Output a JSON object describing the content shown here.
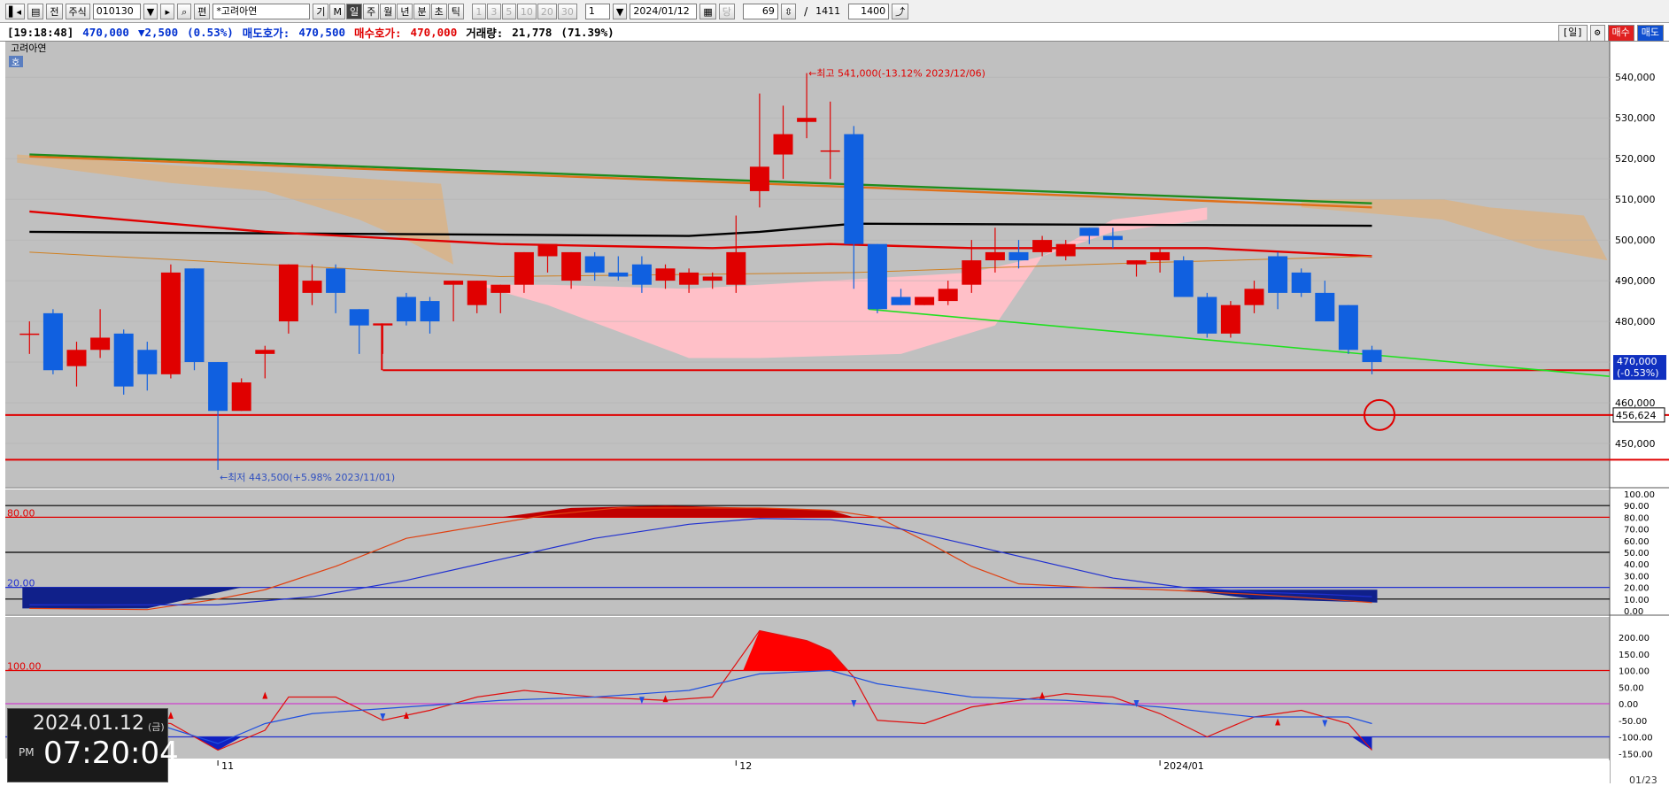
{
  "toolbar": {
    "market_btn": "전",
    "type_label": "주식",
    "code": "010130",
    "search_glyph": "🔍",
    "name_prefix": "편",
    "name": "*고려아연",
    "periods": [
      "기",
      "M",
      "일",
      "주",
      "월",
      "년",
      "분",
      "초",
      "틱"
    ],
    "active_period": "일",
    "intervals": [
      "1",
      "3",
      "5",
      "10",
      "20",
      "30"
    ],
    "interval_value": "1",
    "date": "2024/01/12",
    "mode_label": "당",
    "page_count": "69",
    "page_sep": "/",
    "page_total": "1411",
    "bar_count": "1400"
  },
  "infobar": {
    "time": "[19:18:48]",
    "price": "470,000",
    "change": "▼2,500",
    "change_pct": "(0.53%)",
    "ask_label": "매도호가:",
    "ask_value": "470,500",
    "bid_label": "매수호가:",
    "bid_value": "470,000",
    "volume_label": "거래량:",
    "volume_value": "21,778",
    "volume_pct": "(71.39%)",
    "right_btns": [
      "[일]",
      "⚙",
      "매수",
      "매도"
    ]
  },
  "chart_data": [
    {
      "type": "candlestick",
      "title": "고려아연",
      "badge": "호",
      "ylim": [
        440000,
        547000
      ],
      "yticks": [
        450000,
        460000,
        470000,
        480000,
        490000,
        500000,
        510000,
        520000,
        530000,
        540000
      ],
      "ytick_labels": [
        "450,000",
        "460,000",
        "470,000",
        "480,000",
        "490,000",
        "500,000",
        "510,000",
        "520,000",
        "530,000",
        "540,000"
      ],
      "x_labels": [
        {
          "index": 8,
          "text": "11"
        },
        {
          "index": 30,
          "text": "12"
        },
        {
          "index": 48,
          "text": "2024/01"
        }
      ],
      "candles": [
        {
          "o": 477000,
          "h": 480000,
          "l": 472000,
          "c": 477000
        },
        {
          "o": 482000,
          "h": 483000,
          "l": 467000,
          "c": 468000
        },
        {
          "o": 469000,
          "h": 475000,
          "l": 464000,
          "c": 473000
        },
        {
          "o": 473000,
          "h": 483000,
          "l": 471000,
          "c": 476000
        },
        {
          "o": 477000,
          "h": 478000,
          "l": 462000,
          "c": 464000
        },
        {
          "o": 473000,
          "h": 475000,
          "l": 463000,
          "c": 467000
        },
        {
          "o": 467000,
          "h": 494000,
          "l": 466000,
          "c": 492000
        },
        {
          "o": 493000,
          "h": 493000,
          "l": 468000,
          "c": 470000
        },
        {
          "o": 470000,
          "h": 470000,
          "l": 443500,
          "c": 458000
        },
        {
          "o": 458000,
          "h": 466000,
          "l": 458000,
          "c": 465000
        },
        {
          "o": 472000,
          "h": 474000,
          "l": 466000,
          "c": 473000
        },
        {
          "o": 480000,
          "h": 494000,
          "l": 477000,
          "c": 494000
        },
        {
          "o": 487000,
          "h": 494000,
          "l": 484000,
          "c": 490000
        },
        {
          "o": 493000,
          "h": 494000,
          "l": 482000,
          "c": 487000
        },
        {
          "o": 483000,
          "h": 483000,
          "l": 472000,
          "c": 479000
        },
        {
          "o": 479000,
          "h": 479000,
          "l": 472000,
          "c": 479500
        },
        {
          "o": 486000,
          "h": 487000,
          "l": 479000,
          "c": 480000
        },
        {
          "o": 485000,
          "h": 486000,
          "l": 477000,
          "c": 480000
        },
        {
          "o": 489000,
          "h": 490000,
          "l": 480000,
          "c": 490000
        },
        {
          "o": 484000,
          "h": 490000,
          "l": 482000,
          "c": 490000
        },
        {
          "o": 487000,
          "h": 489000,
          "l": 482000,
          "c": 489000
        },
        {
          "o": 489000,
          "h": 497000,
          "l": 487000,
          "c": 497000
        },
        {
          "o": 496000,
          "h": 497000,
          "l": 492000,
          "c": 499000
        },
        {
          "o": 490000,
          "h": 497000,
          "l": 488000,
          "c": 497000
        },
        {
          "o": 496000,
          "h": 497000,
          "l": 490000,
          "c": 492000
        },
        {
          "o": 492000,
          "h": 496000,
          "l": 490000,
          "c": 491000
        },
        {
          "o": 494000,
          "h": 496000,
          "l": 487000,
          "c": 489000
        },
        {
          "o": 490000,
          "h": 494000,
          "l": 488000,
          "c": 493000
        },
        {
          "o": 489000,
          "h": 493000,
          "l": 487000,
          "c": 492000
        },
        {
          "o": 490000,
          "h": 492000,
          "l": 488000,
          "c": 491000
        },
        {
          "o": 489000,
          "h": 506000,
          "l": 487000,
          "c": 497000
        },
        {
          "o": 512000,
          "h": 536000,
          "l": 508000,
          "c": 518000
        },
        {
          "o": 521000,
          "h": 533000,
          "l": 515000,
          "c": 526000
        },
        {
          "o": 529000,
          "h": 541000,
          "l": 525000,
          "c": 530000
        },
        {
          "o": 522000,
          "h": 534000,
          "l": 515000,
          "c": 522000
        },
        {
          "o": 526000,
          "h": 528000,
          "l": 488000,
          "c": 499000
        },
        {
          "o": 499000,
          "h": 499000,
          "l": 482000,
          "c": 483000
        },
        {
          "o": 486000,
          "h": 488000,
          "l": 484000,
          "c": 484000
        },
        {
          "o": 484000,
          "h": 486000,
          "l": 484000,
          "c": 486000
        },
        {
          "o": 485000,
          "h": 490000,
          "l": 484000,
          "c": 488000
        },
        {
          "o": 489000,
          "h": 500000,
          "l": 487000,
          "c": 495000
        },
        {
          "o": 495000,
          "h": 503000,
          "l": 492000,
          "c": 497000
        },
        {
          "o": 497000,
          "h": 500000,
          "l": 493000,
          "c": 495000
        },
        {
          "o": 497000,
          "h": 501000,
          "l": 496000,
          "c": 500000
        },
        {
          "o": 496000,
          "h": 500000,
          "l": 495000,
          "c": 499000
        },
        {
          "o": 503000,
          "h": 503000,
          "l": 499000,
          "c": 501000
        },
        {
          "o": 501000,
          "h": 503000,
          "l": 498000,
          "c": 500000
        },
        {
          "o": 494000,
          "h": 495000,
          "l": 491000,
          "c": 495000
        },
        {
          "o": 495000,
          "h": 498000,
          "l": 492000,
          "c": 497000
        },
        {
          "o": 495000,
          "h": 496000,
          "l": 486000,
          "c": 486000
        },
        {
          "o": 486000,
          "h": 487000,
          "l": 476000,
          "c": 477000
        },
        {
          "o": 477000,
          "h": 485000,
          "l": 476000,
          "c": 484000
        },
        {
          "o": 484000,
          "h": 490000,
          "l": 482000,
          "c": 488000
        },
        {
          "o": 496000,
          "h": 497000,
          "l": 483000,
          "c": 487000
        },
        {
          "o": 492000,
          "h": 493000,
          "l": 486000,
          "c": 487000
        },
        {
          "o": 487000,
          "h": 490000,
          "l": 480000,
          "c": 480000
        },
        {
          "o": 484000,
          "h": 484000,
          "l": 472000,
          "c": 473000
        },
        {
          "o": 473000,
          "h": 474000,
          "l": 467000,
          "c": 470000
        }
      ],
      "moving_averages": [
        {
          "name": "MA-green",
          "color": "#1e8c1e",
          "points": [
            [
              0,
              521000
            ],
            [
              57,
              509000
            ]
          ]
        },
        {
          "name": "MA-orange",
          "color": "#e0701a",
          "points": [
            [
              0,
              520500
            ],
            [
              35,
              513000
            ],
            [
              57,
              508000
            ]
          ]
        },
        {
          "name": "MA-black",
          "color": "#000000",
          "points": [
            [
              0,
              502000
            ],
            [
              28,
              501000
            ],
            [
              31,
              502000
            ],
            [
              35,
              504000
            ],
            [
              57,
              503500
            ]
          ]
        },
        {
          "name": "MA-red",
          "color": "#e00000",
          "points": [
            [
              0,
              507000
            ],
            [
              10,
              502000
            ],
            [
              20,
              499000
            ],
            [
              29,
              498000
            ],
            [
              34,
              499000
            ],
            [
              40,
              498000
            ],
            [
              50,
              498000
            ],
            [
              57,
              496000
            ]
          ]
        },
        {
          "name": "MA-orange-thin",
          "color": "#d08020",
          "points": [
            [
              0,
              497000
            ],
            [
              10,
              494000
            ],
            [
              20,
              491000
            ],
            [
              35,
              492000
            ],
            [
              45,
              494000
            ],
            [
              57,
              496000
            ]
          ]
        }
      ],
      "annotations": [
        {
          "text": "←최고 541,000(-13.12% 2023/12/06)",
          "index": 33,
          "value": 541000,
          "color": "#e00000"
        },
        {
          "text": "←최저 443,500(+5.98% 2023/11/01)",
          "index": 8,
          "value": 443500,
          "color": "#3050c0"
        }
      ],
      "levels": [
        {
          "value": 468000,
          "color": "#e00000"
        },
        {
          "value": 457000,
          "color": "#e00000"
        },
        {
          "value": 446000,
          "color": "#e00000"
        }
      ],
      "last_price_label": "470,000",
      "last_pct_label": "(-0.53%)",
      "level_label": "456,624"
    },
    {
      "type": "line",
      "name": "stochastic",
      "ylim": [
        0,
        100
      ],
      "yticks": [
        0,
        10,
        20,
        30,
        40,
        50,
        60,
        70,
        80,
        90,
        100
      ],
      "ytick_labels": [
        "0.00",
        "10.00",
        "20.00",
        "30.00",
        "40.00",
        "50.00",
        "60.00",
        "70.00",
        "80.00",
        "90.00",
        "100.00"
      ],
      "ref_labels": [
        "80.00",
        "20.00"
      ],
      "series": [
        {
          "color": "#e04010",
          "values": [
            [
              0,
              2
            ],
            [
              5,
              1
            ],
            [
              8,
              10
            ],
            [
              10,
              18
            ],
            [
              13,
              38
            ],
            [
              16,
              62
            ],
            [
              19,
              72
            ],
            [
              22,
              82
            ],
            [
              25,
              88
            ],
            [
              28,
              88
            ],
            [
              31,
              88
            ],
            [
              34,
              86
            ],
            [
              36,
              80
            ],
            [
              38,
              60
            ],
            [
              40,
              38
            ],
            [
              42,
              23
            ],
            [
              45,
              20
            ],
            [
              48,
              18
            ],
            [
              52,
              14
            ],
            [
              55,
              10
            ],
            [
              57,
              7
            ]
          ]
        },
        {
          "color": "#2030d0",
          "values": [
            [
              0,
              5
            ],
            [
              8,
              5
            ],
            [
              12,
              12
            ],
            [
              16,
              26
            ],
            [
              20,
              44
            ],
            [
              24,
              62
            ],
            [
              28,
              74
            ],
            [
              31,
              79
            ],
            [
              34,
              78
            ],
            [
              37,
              70
            ],
            [
              40,
              56
            ],
            [
              43,
              42
            ],
            [
              46,
              28
            ],
            [
              49,
              20
            ],
            [
              52,
              16
            ],
            [
              55,
              14
            ],
            [
              57,
              12
            ]
          ]
        }
      ]
    },
    {
      "type": "line",
      "name": "cci",
      "ylim": [
        -160,
        240
      ],
      "yticks": [
        -150,
        -100,
        -50,
        0,
        50,
        100,
        150,
        200
      ],
      "ytick_labels": [
        "-150.00",
        "-100.00",
        "-50.00",
        "0.00",
        "50.00",
        "100.00",
        "150.00",
        "200.00"
      ],
      "ref_labels": [
        "100.00"
      ],
      "series": [
        {
          "color": "#e01010",
          "values": [
            [
              0,
              -20
            ],
            [
              3,
              -40
            ],
            [
              6,
              -60
            ],
            [
              8,
              -140
            ],
            [
              10,
              -80
            ],
            [
              11,
              20
            ],
            [
              13,
              20
            ],
            [
              15,
              -50
            ],
            [
              17,
              -20
            ],
            [
              19,
              20
            ],
            [
              21,
              40
            ],
            [
              24,
              20
            ],
            [
              27,
              10
            ],
            [
              29,
              20
            ],
            [
              31,
              220
            ],
            [
              33,
              190
            ],
            [
              34,
              160
            ],
            [
              35,
              80
            ],
            [
              36,
              -50
            ],
            [
              38,
              -60
            ],
            [
              40,
              -10
            ],
            [
              42,
              10
            ],
            [
              44,
              30
            ],
            [
              46,
              20
            ],
            [
              48,
              -30
            ],
            [
              50,
              -100
            ],
            [
              52,
              -40
            ],
            [
              54,
              -20
            ],
            [
              56,
              -60
            ],
            [
              57,
              -140
            ]
          ]
        },
        {
          "color": "#2050e0",
          "values": [
            [
              0,
              -20
            ],
            [
              4,
              -30
            ],
            [
              8,
              -120
            ],
            [
              10,
              -60
            ],
            [
              12,
              -30
            ],
            [
              16,
              -10
            ],
            [
              20,
              10
            ],
            [
              24,
              20
            ],
            [
              28,
              40
            ],
            [
              31,
              90
            ],
            [
              34,
              100
            ],
            [
              36,
              60
            ],
            [
              40,
              20
            ],
            [
              44,
              10
            ],
            [
              48,
              -10
            ],
            [
              52,
              -40
            ],
            [
              56,
              -40
            ],
            [
              57,
              -60
            ]
          ]
        }
      ]
    }
  ],
  "clock": {
    "date": "2024.01.12",
    "weekday": "(금)",
    "ampm": "PM",
    "time": "07:20:04"
  },
  "right_panel": {
    "date_label": "01/23"
  }
}
